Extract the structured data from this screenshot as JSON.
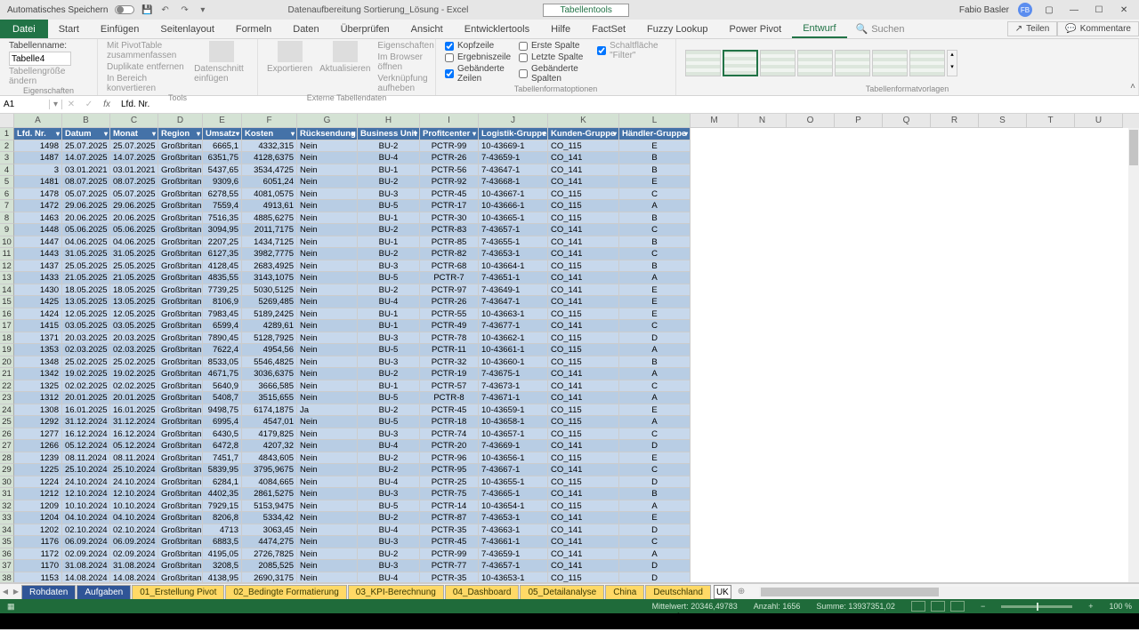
{
  "title_bar": {
    "autosave_label": "Automatisches Speichern",
    "doc_title": "Datenaufbereitung Sortierung_Lösung  -  Excel",
    "context_tab": "Tabellentools",
    "user_name": "Fabio Basler",
    "user_initials": "FB"
  },
  "ribbon": {
    "tabs": [
      "Datei",
      "Start",
      "Einfügen",
      "Seitenlayout",
      "Formeln",
      "Daten",
      "Überprüfen",
      "Ansicht",
      "Entwicklertools",
      "Hilfe",
      "FactSet",
      "Fuzzy Lookup",
      "Power Pivot",
      "Entwurf"
    ],
    "active_tab": "Entwurf",
    "search_placeholder": "Suchen",
    "share_label": "Teilen",
    "comments_label": "Kommentare",
    "groups": {
      "eigenschaften": {
        "label": "Eigenschaften",
        "table_name_label": "Tabellenname:",
        "table_name_value": "Tabelle4",
        "resize": "Tabellengröße ändern"
      },
      "tools": {
        "label": "Tools",
        "pivot": "Mit PivotTable zusammenfassen",
        "dup": "Duplikate entfernen",
        "convert": "In Bereich konvertieren",
        "slicer": "Datenschnitt einfügen"
      },
      "extern": {
        "label": "Externe Tabellendaten",
        "export": "Exportieren",
        "refresh": "Aktualisieren",
        "props": "Eigenschaften",
        "browser": "Im Browser öffnen",
        "unlink": "Verknüpfung aufheben"
      },
      "styleopts": {
        "label": "Tabellenformatoptionen",
        "header_row": "Kopfzeile",
        "total_row": "Ergebniszeile",
        "banded_rows": "Gebänderte Zeilen",
        "first_col": "Erste Spalte",
        "last_col": "Letzte Spalte",
        "banded_cols": "Gebänderte Spalten",
        "filter_btn": "Schaltfläche \"Filter\""
      },
      "styles": {
        "label": "Tabellenformatvorlagen"
      }
    }
  },
  "name_box": "A1",
  "formula_bar": "Lfd. Nr.",
  "columns": [
    "A",
    "B",
    "C",
    "D",
    "E",
    "F",
    "G",
    "H",
    "I",
    "J",
    "K",
    "L",
    "M",
    "N",
    "O",
    "P",
    "Q",
    "R",
    "S",
    "T",
    "U"
  ],
  "table_headers": [
    "Lfd. Nr.",
    "Datum",
    "Monat",
    "Region",
    "Umsatz",
    "Kosten",
    "Rücksendung",
    "Business Unit",
    "Profitcenter",
    "Logistik-Gruppe",
    "Kunden-Gruppe",
    "Händler-Gruppe"
  ],
  "rows": [
    [
      1498,
      "25.07.2025",
      "25.07.2025",
      "Großbritanni",
      "6665,1",
      "4332,315",
      "Nein",
      "BU-2",
      "PCTR-99",
      "10-43669-1",
      "CO_115",
      "E"
    ],
    [
      1487,
      "14.07.2025",
      "14.07.2025",
      "Großbritanni",
      "6351,75",
      "4128,6375",
      "Nein",
      "BU-4",
      "PCTR-26",
      "7-43659-1",
      "CO_141",
      "B"
    ],
    [
      3,
      "03.01.2021",
      "03.01.2021",
      "Großbritanni",
      "5437,65",
      "3534,4725",
      "Nein",
      "BU-1",
      "PCTR-56",
      "7-43647-1",
      "CO_141",
      "B"
    ],
    [
      1481,
      "08.07.2025",
      "08.07.2025",
      "Großbritanni",
      "9309,6",
      "6051,24",
      "Nein",
      "BU-2",
      "PCTR-92",
      "7-43668-1",
      "CO_141",
      "E"
    ],
    [
      1478,
      "05.07.2025",
      "05.07.2025",
      "Großbritanni",
      "6278,55",
      "4081,0575",
      "Nein",
      "BU-3",
      "PCTR-45",
      "10-43667-1",
      "CO_115",
      "C"
    ],
    [
      1472,
      "29.06.2025",
      "29.06.2025",
      "Großbritanni",
      "7559,4",
      "4913,61",
      "Nein",
      "BU-5",
      "PCTR-17",
      "10-43666-1",
      "CO_115",
      "A"
    ],
    [
      1463,
      "20.06.2025",
      "20.06.2025",
      "Großbritanni",
      "7516,35",
      "4885,6275",
      "Nein",
      "BU-1",
      "PCTR-30",
      "10-43665-1",
      "CO_115",
      "B"
    ],
    [
      1448,
      "05.06.2025",
      "05.06.2025",
      "Großbritanni",
      "3094,95",
      "2011,7175",
      "Nein",
      "BU-2",
      "PCTR-83",
      "7-43657-1",
      "CO_141",
      "C"
    ],
    [
      1447,
      "04.06.2025",
      "04.06.2025",
      "Großbritanni",
      "2207,25",
      "1434,7125",
      "Nein",
      "BU-1",
      "PCTR-85",
      "7-43655-1",
      "CO_141",
      "B"
    ],
    [
      1443,
      "31.05.2025",
      "31.05.2025",
      "Großbritanni",
      "6127,35",
      "3982,7775",
      "Nein",
      "BU-2",
      "PCTR-82",
      "7-43653-1",
      "CO_141",
      "C"
    ],
    [
      1437,
      "25.05.2025",
      "25.05.2025",
      "Großbritanni",
      "4128,45",
      "2683,4925",
      "Nein",
      "BU-3",
      "PCTR-68",
      "10-43664-1",
      "CO_115",
      "B"
    ],
    [
      1433,
      "21.05.2025",
      "21.05.2025",
      "Großbritanni",
      "4835,55",
      "3143,1075",
      "Nein",
      "BU-5",
      "PCTR-7",
      "7-43651-1",
      "CO_141",
      "A"
    ],
    [
      1430,
      "18.05.2025",
      "18.05.2025",
      "Großbritanni",
      "7739,25",
      "5030,5125",
      "Nein",
      "BU-2",
      "PCTR-97",
      "7-43649-1",
      "CO_141",
      "E"
    ],
    [
      1425,
      "13.05.2025",
      "13.05.2025",
      "Großbritanni",
      "8106,9",
      "5269,485",
      "Nein",
      "BU-4",
      "PCTR-26",
      "7-43647-1",
      "CO_141",
      "E"
    ],
    [
      1424,
      "12.05.2025",
      "12.05.2025",
      "Großbritanni",
      "7983,45",
      "5189,2425",
      "Nein",
      "BU-1",
      "PCTR-55",
      "10-43663-1",
      "CO_115",
      "E"
    ],
    [
      1415,
      "03.05.2025",
      "03.05.2025",
      "Großbritanni",
      "6599,4",
      "4289,61",
      "Nein",
      "BU-1",
      "PCTR-49",
      "7-43677-1",
      "CO_141",
      "C"
    ],
    [
      1371,
      "20.03.2025",
      "20.03.2025",
      "Großbritanni",
      "7890,45",
      "5128,7925",
      "Nein",
      "BU-3",
      "PCTR-78",
      "10-43662-1",
      "CO_115",
      "D"
    ],
    [
      1353,
      "02.03.2025",
      "02.03.2025",
      "Großbritanni",
      "7622,4",
      "4954,56",
      "Nein",
      "BU-5",
      "PCTR-11",
      "10-43661-1",
      "CO_115",
      "A"
    ],
    [
      1348,
      "25.02.2025",
      "25.02.2025",
      "Großbritanni",
      "8533,05",
      "5546,4825",
      "Nein",
      "BU-3",
      "PCTR-32",
      "10-43660-1",
      "CO_115",
      "B"
    ],
    [
      1342,
      "19.02.2025",
      "19.02.2025",
      "Großbritanni",
      "4671,75",
      "3036,6375",
      "Nein",
      "BU-2",
      "PCTR-19",
      "7-43675-1",
      "CO_141",
      "A"
    ],
    [
      1325,
      "02.02.2025",
      "02.02.2025",
      "Großbritanni",
      "5640,9",
      "3666,585",
      "Nein",
      "BU-1",
      "PCTR-57",
      "7-43673-1",
      "CO_141",
      "C"
    ],
    [
      1312,
      "20.01.2025",
      "20.01.2025",
      "Großbritanni",
      "5408,7",
      "3515,655",
      "Nein",
      "BU-5",
      "PCTR-8",
      "7-43671-1",
      "CO_141",
      "A"
    ],
    [
      1308,
      "16.01.2025",
      "16.01.2025",
      "Großbritanni",
      "9498,75",
      "6174,1875",
      "Ja",
      "BU-2",
      "PCTR-45",
      "10-43659-1",
      "CO_115",
      "E"
    ],
    [
      1292,
      "31.12.2024",
      "31.12.2024",
      "Großbritanni",
      "6995,4",
      "4547,01",
      "Nein",
      "BU-5",
      "PCTR-18",
      "10-43658-1",
      "CO_115",
      "A"
    ],
    [
      1277,
      "16.12.2024",
      "16.12.2024",
      "Großbritanni",
      "6430,5",
      "4179,825",
      "Nein",
      "BU-3",
      "PCTR-74",
      "10-43657-1",
      "CO_115",
      "C"
    ],
    [
      1266,
      "05.12.2024",
      "05.12.2024",
      "Großbritanni",
      "6472,8",
      "4207,32",
      "Nein",
      "BU-4",
      "PCTR-20",
      "7-43669-1",
      "CO_141",
      "D"
    ],
    [
      1239,
      "08.11.2024",
      "08.11.2024",
      "Großbritanni",
      "7451,7",
      "4843,605",
      "Nein",
      "BU-2",
      "PCTR-96",
      "10-43656-1",
      "CO_115",
      "E"
    ],
    [
      1225,
      "25.10.2024",
      "25.10.2024",
      "Großbritanni",
      "5839,95",
      "3795,9675",
      "Nein",
      "BU-2",
      "PCTR-95",
      "7-43667-1",
      "CO_141",
      "C"
    ],
    [
      1224,
      "24.10.2024",
      "24.10.2024",
      "Großbritanni",
      "6284,1",
      "4084,665",
      "Nein",
      "BU-4",
      "PCTR-25",
      "10-43655-1",
      "CO_115",
      "D"
    ],
    [
      1212,
      "12.10.2024",
      "12.10.2024",
      "Großbritanni",
      "4402,35",
      "2861,5275",
      "Nein",
      "BU-3",
      "PCTR-75",
      "7-43665-1",
      "CO_141",
      "B"
    ],
    [
      1209,
      "10.10.2024",
      "10.10.2024",
      "Großbritanni",
      "7929,15",
      "5153,9475",
      "Nein",
      "BU-5",
      "PCTR-14",
      "10-43654-1",
      "CO_115",
      "A"
    ],
    [
      1204,
      "04.10.2024",
      "04.10.2024",
      "Großbritanni",
      "8206,8",
      "5334,42",
      "Nein",
      "BU-2",
      "PCTR-87",
      "7-43653-1",
      "CO_141",
      "E"
    ],
    [
      1202,
      "02.10.2024",
      "02.10.2024",
      "Großbritanni",
      "4713",
      "3063,45",
      "Nein",
      "BU-4",
      "PCTR-35",
      "7-43663-1",
      "CO_141",
      "D"
    ],
    [
      1176,
      "06.09.2024",
      "06.09.2024",
      "Großbritanni",
      "6883,5",
      "4474,275",
      "Nein",
      "BU-3",
      "PCTR-45",
      "7-43661-1",
      "CO_141",
      "C"
    ],
    [
      1172,
      "02.09.2024",
      "02.09.2024",
      "Großbritanni",
      "4195,05",
      "2726,7825",
      "Nein",
      "BU-2",
      "PCTR-99",
      "7-43659-1",
      "CO_141",
      "A"
    ],
    [
      1170,
      "31.08.2024",
      "31.08.2024",
      "Großbritanni",
      "3208,5",
      "2085,525",
      "Nein",
      "BU-3",
      "PCTR-77",
      "7-43657-1",
      "CO_141",
      "D"
    ],
    [
      1153,
      "14.08.2024",
      "14.08.2024",
      "Großbritanni",
      "4138,95",
      "2690,3175",
      "Nein",
      "BU-4",
      "PCTR-35",
      "10-43653-1",
      "CO_115",
      "D"
    ]
  ],
  "sheet_tabs": {
    "blue": [
      "Rohdaten",
      "Aufgaben"
    ],
    "yellow": [
      "01_Erstellung Pivot",
      "02_Bedingte Formatierung",
      "03_KPI-Berechnung",
      "04_Dashboard",
      "05_Detailanalyse",
      "China",
      "Deutschland"
    ],
    "editing": "UK"
  },
  "status": {
    "mittelwert_label": "Mittelwert:",
    "mittelwert_val": "20346,49783",
    "anzahl_label": "Anzahl:",
    "anzahl_val": "1656",
    "summe_label": "Summe:",
    "summe_val": "13937351,02",
    "zoom": "100 %"
  }
}
